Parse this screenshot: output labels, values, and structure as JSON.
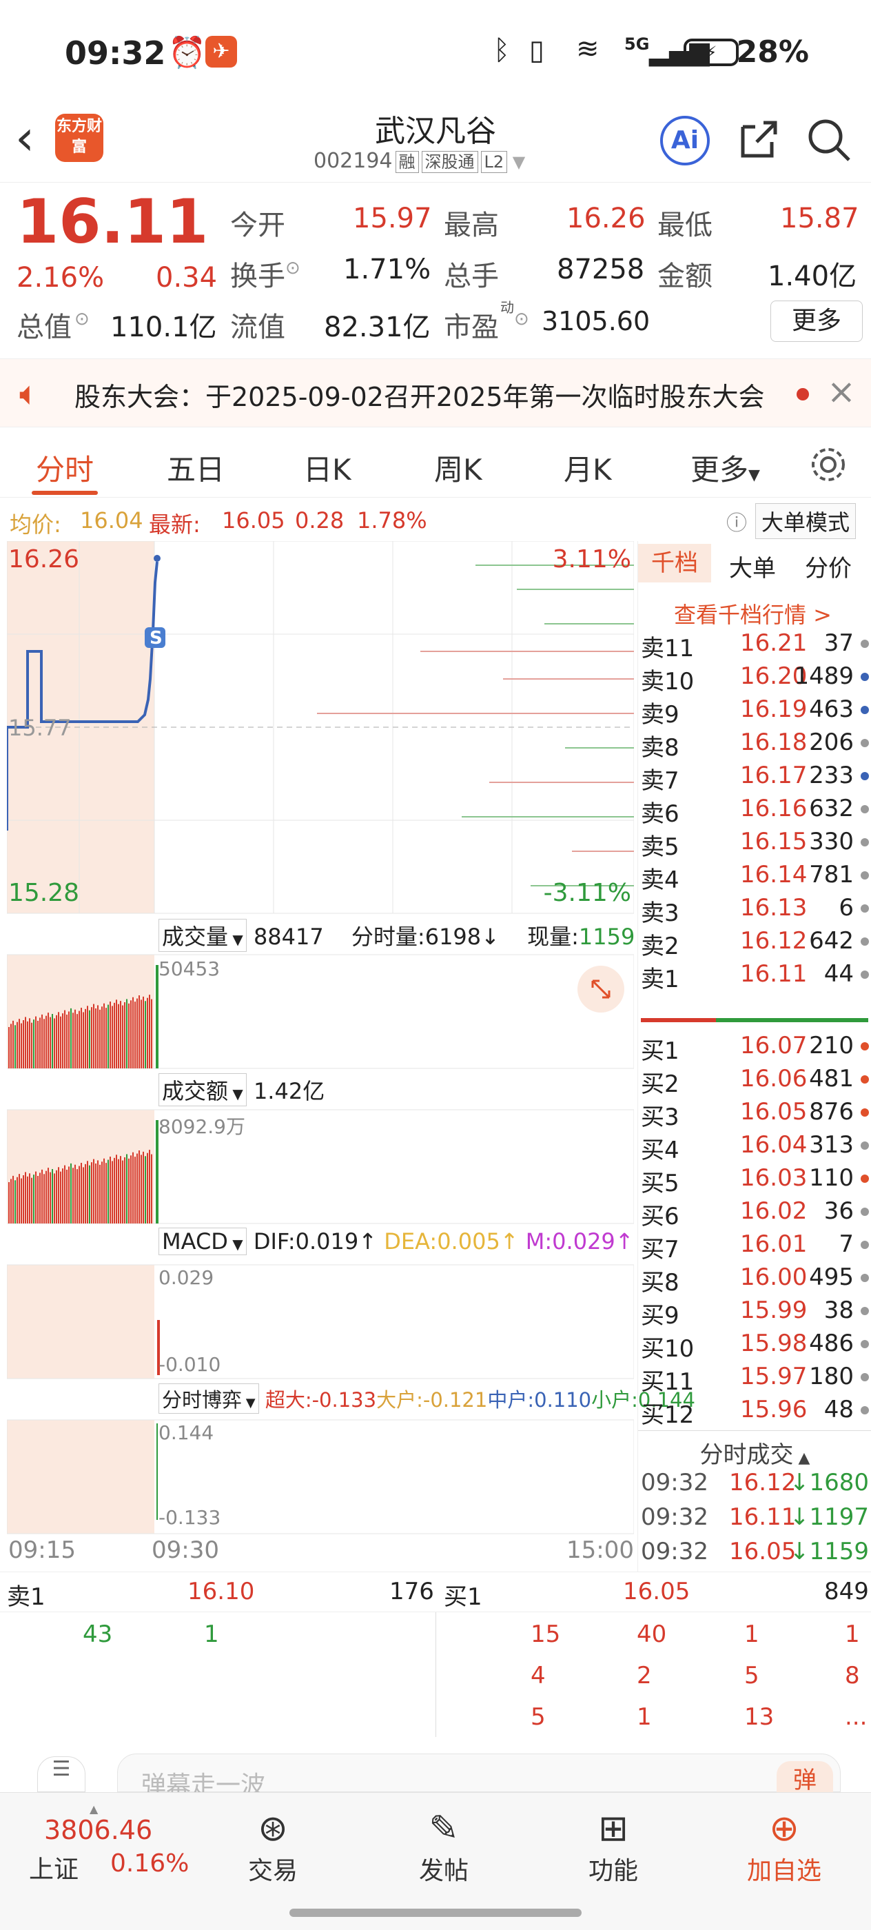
{
  "status": {
    "time": "09:32",
    "battery": "28%",
    "network": "5G"
  },
  "header": {
    "logo_text": "东方财富",
    "stock_name": "武汉凡谷",
    "code": "002194",
    "tags": [
      "融",
      "深股通",
      "L2"
    ],
    "ai_label": "Ai"
  },
  "quote": {
    "price": "16.11",
    "change_pct": "2.16%",
    "change": "0.34",
    "open_label": "今开",
    "open": "15.97",
    "high_label": "最高",
    "high": "16.26",
    "low_label": "最低",
    "low": "15.87",
    "turnover_label": "换手",
    "turnover": "1.71%",
    "volume_label": "总手",
    "volume": "87258",
    "amount_label": "金额",
    "amount": "1.40亿",
    "mcap_label": "总值",
    "mcap": "110.1亿",
    "float_label": "流值",
    "float": "82.31亿",
    "pe_label": "市盈",
    "pe_sup": "动",
    "pe": "3105.60",
    "more_label": "更多"
  },
  "notice": {
    "text": "股东大会：于2025-09-02召开2025年第一次临时股东大会"
  },
  "tabs": [
    "分时",
    "五日",
    "日K",
    "周K",
    "月K",
    "更多"
  ],
  "subinfo": {
    "avg_label": "均价:",
    "avg": "16.04",
    "latest_label": "最新:",
    "latest": "16.05",
    "latest_chg": "0.28",
    "latest_pct": "1.78%",
    "mode_label": "大单模式"
  },
  "chart": {
    "top_price": "16.26",
    "bottom_price": "15.28",
    "mid_price": "15.77",
    "top_pct": "3.11%",
    "bottom_pct": "-3.11%",
    "marker": "S",
    "vol_label": "成交量",
    "vol_total": "88417",
    "vol_min_label": "分时量:",
    "vol_min": "6198↓",
    "vol_now_label": "现量:",
    "vol_now": "1159",
    "vol_axis": "50453",
    "amt_label": "成交额",
    "amt_total": "1.42亿",
    "amt_axis": "8092.9万",
    "macd_label": "MACD",
    "dif": "DIF:0.019↑",
    "dea": "DEA:0.005↑",
    "m": "M:0.029↑",
    "macd_top": "0.029",
    "macd_bottom": "-0.010",
    "game_label": "分时博弈",
    "super": "超大:-0.133",
    "big": "大户:-0.121",
    "mid": "中户:0.110",
    "small": "小户:0.144",
    "game_top": "0.144",
    "game_bottom": "-0.133",
    "time_start": "09:15",
    "time_open": "09:30",
    "time_end": "15:00"
  },
  "book": {
    "tabs": [
      "千档",
      "大单",
      "分价"
    ],
    "link": "查看千档行情 >",
    "sells": [
      {
        "l": "卖11",
        "p": "16.21",
        "v": "37",
        "c": "#999"
      },
      {
        "l": "卖10",
        "p": "16.20",
        "v": "1489",
        "c": "#3a63b5"
      },
      {
        "l": "卖9",
        "p": "16.19",
        "v": "463",
        "c": "#3a63b5"
      },
      {
        "l": "卖8",
        "p": "16.18",
        "v": "206",
        "c": "#999"
      },
      {
        "l": "卖7",
        "p": "16.17",
        "v": "233",
        "c": "#3a63b5"
      },
      {
        "l": "卖6",
        "p": "16.16",
        "v": "632",
        "c": "#999"
      },
      {
        "l": "卖5",
        "p": "16.15",
        "v": "330",
        "c": "#999"
      },
      {
        "l": "卖4",
        "p": "16.14",
        "v": "781",
        "c": "#999"
      },
      {
        "l": "卖3",
        "p": "16.13",
        "v": "6",
        "c": "#999"
      },
      {
        "l": "卖2",
        "p": "16.12",
        "v": "642",
        "c": "#999"
      },
      {
        "l": "卖1",
        "p": "16.11",
        "v": "44",
        "c": "#999"
      }
    ],
    "buys": [
      {
        "l": "买1",
        "p": "16.07",
        "v": "210",
        "c": "#e0502a"
      },
      {
        "l": "买2",
        "p": "16.06",
        "v": "481",
        "c": "#e0502a"
      },
      {
        "l": "买3",
        "p": "16.05",
        "v": "876",
        "c": "#e0502a"
      },
      {
        "l": "买4",
        "p": "16.04",
        "v": "313",
        "c": "#999"
      },
      {
        "l": "买5",
        "p": "16.03",
        "v": "110",
        "c": "#e0502a"
      },
      {
        "l": "买6",
        "p": "16.02",
        "v": "36",
        "c": "#999"
      },
      {
        "l": "买7",
        "p": "16.01",
        "v": "7",
        "c": "#999"
      },
      {
        "l": "买8",
        "p": "16.00",
        "v": "495",
        "c": "#999"
      },
      {
        "l": "买9",
        "p": "15.99",
        "v": "38",
        "c": "#999"
      },
      {
        "l": "买10",
        "p": "15.98",
        "v": "486",
        "c": "#999"
      },
      {
        "l": "买11",
        "p": "15.97",
        "v": "180",
        "c": "#999"
      },
      {
        "l": "买12",
        "p": "15.96",
        "v": "48",
        "c": "#999"
      }
    ],
    "trades_title": "分时成交",
    "trades": [
      {
        "t": "09:32",
        "p": "16.12",
        "v": "↓1680"
      },
      {
        "t": "09:32",
        "p": "16.11",
        "v": "↓1197"
      },
      {
        "t": "09:32",
        "p": "16.05",
        "v": "↓1159"
      }
    ]
  },
  "bottom": {
    "sell_label": "卖1",
    "sell_price": "16.10",
    "sell_qty": "176",
    "sell_queue": [
      "43",
      "1"
    ],
    "buy_label": "买1",
    "buy_price": "16.05",
    "buy_qty": "849",
    "buy_queue": [
      "15",
      "40",
      "1",
      "1",
      "4",
      "2",
      "5",
      "8",
      "5",
      "1",
      "13",
      "..."
    ]
  },
  "comment": {
    "placeholder": "弹幕走一波",
    "btn": "弹"
  },
  "nav": {
    "index_value": "3806.46",
    "index_name": "上证",
    "index_pct": "0.16%",
    "items": [
      "交易",
      "发帖",
      "功能",
      "加自选"
    ]
  }
}
